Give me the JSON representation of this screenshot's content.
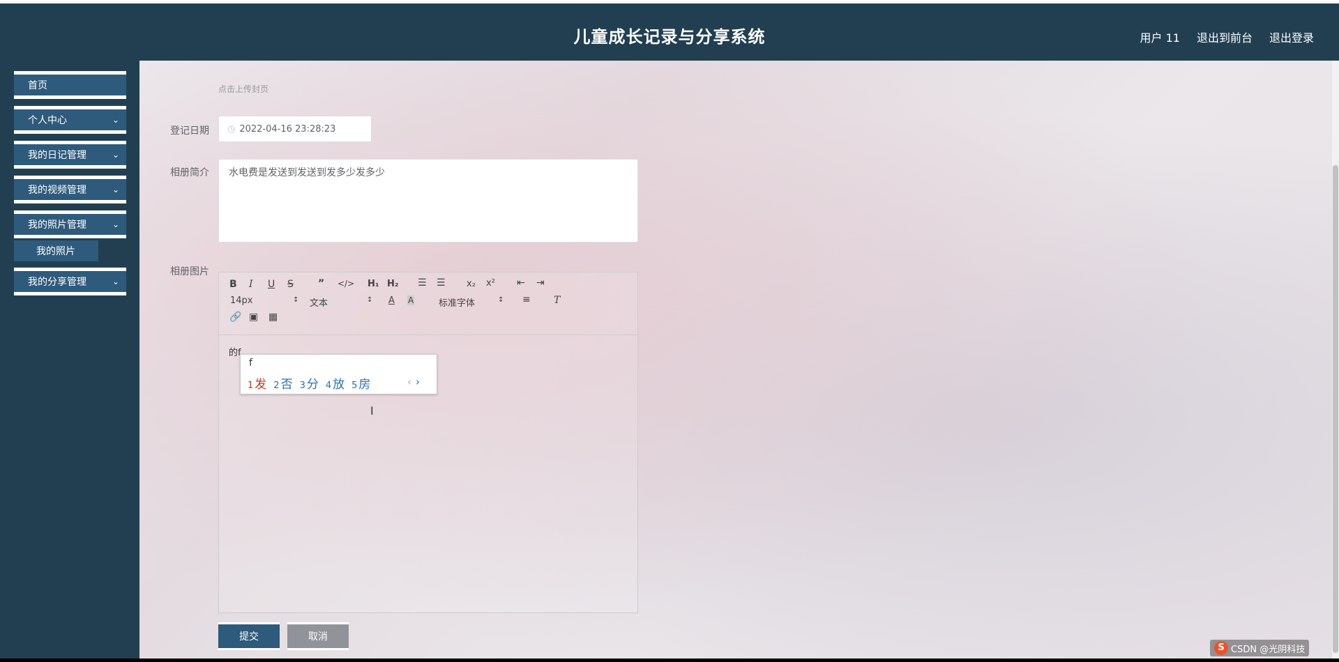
{
  "header": {
    "title": "儿童成长记录与分享系统",
    "nav": [
      "用户 11",
      "退出到前台",
      "退出登录"
    ]
  },
  "sidebar": {
    "items": [
      {
        "label": "首页",
        "has_chevron": false
      },
      {
        "label": "个人中心",
        "has_chevron": true
      },
      {
        "label": "我的日记管理",
        "has_chevron": true
      },
      {
        "label": "我的视频管理",
        "has_chevron": true
      },
      {
        "label": "我的照片管理",
        "has_chevron": true
      },
      {
        "label": "我的分享管理",
        "has_chevron": true
      }
    ],
    "submenu": {
      "label": "我的照片"
    }
  },
  "form": {
    "cover_hint": "点击上传封页",
    "date_label": "登记日期",
    "date_value": "2022-04-16 23:28:23",
    "intro_label": "相册简介",
    "intro_value": "水电费是发送到发送到发多少发多少",
    "images_label": "相册图片",
    "editor": {
      "font_size": "14px",
      "block_format": "文本",
      "font_family": "标准字体",
      "content": "的f"
    },
    "submit_label": "提交",
    "cancel_label": "取消"
  },
  "ime": {
    "pinyin": "f",
    "candidates": [
      {
        "num": "1",
        "text": "发"
      },
      {
        "num": "2",
        "text": "否"
      },
      {
        "num": "3",
        "text": "分"
      },
      {
        "num": "4",
        "text": "放"
      },
      {
        "num": "5",
        "text": "房"
      }
    ]
  },
  "watermark": {
    "text": "CSDN @光阴科技"
  },
  "colors": {
    "header_bg": "#223f52",
    "menu_bg": "#2e5a7c",
    "cancel_bg": "#909399",
    "ime_highlight": "#d2371c",
    "ime_candidate": "#2a6fb5"
  }
}
